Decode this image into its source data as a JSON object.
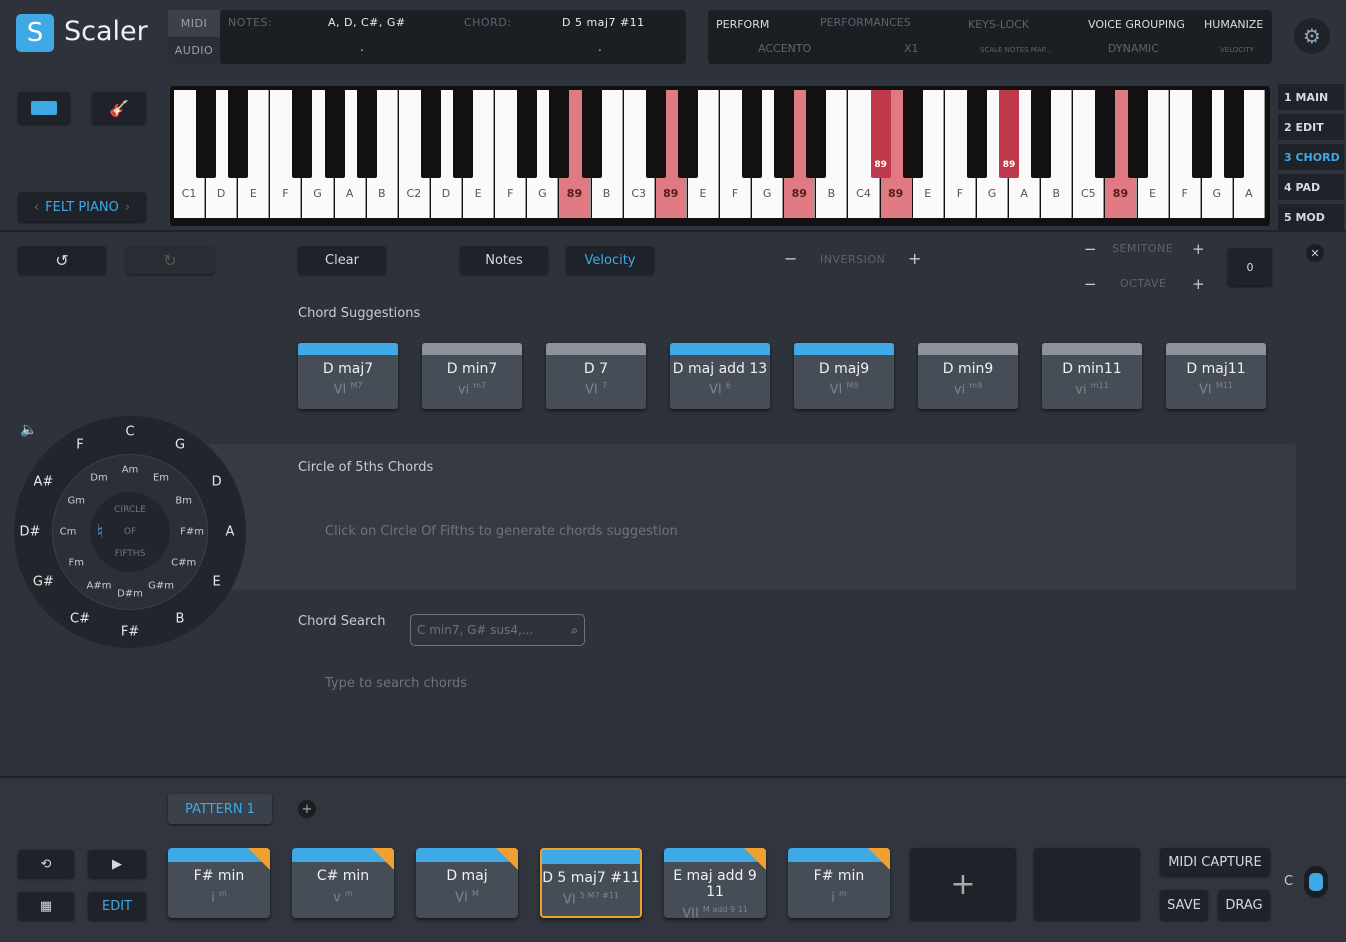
{
  "app": {
    "name": "Scaler",
    "logo_glyph": "S"
  },
  "header": {
    "midi": "MIDI",
    "audio": "AUDIO",
    "notes_label": "NOTES:",
    "notes_value": "A, D, C#, G#",
    "notes_audio": ".",
    "chord_label": "CHORD:",
    "chord_value": "D 5 maj7 #11",
    "chord_audio": ".",
    "perform": "PERFORM",
    "performances": "PERFORMANCES",
    "accento": "ACCENTO",
    "x1": "X1",
    "keys_lock": "KEYS-LOCK",
    "scale_notes_map": "SCALE NOTES MAP...",
    "voice_grouping": "VOICE GROUPING",
    "dynamic": "DYNAMIC",
    "humanize": "HUMANIZE",
    "velocity": "VELOCITY"
  },
  "instrument": {
    "name": "FELT PIANO"
  },
  "piano": {
    "white": [
      "C1",
      "D",
      "E",
      "F",
      "G",
      "A",
      "B",
      "C2",
      "D",
      "E",
      "F",
      "G",
      "89",
      "B",
      "C3",
      "89",
      "E",
      "F",
      "G",
      "89",
      "B",
      "C4",
      "89",
      "E",
      "F",
      "G",
      "A",
      "B",
      "C5",
      "89",
      "E",
      "F",
      "G",
      "A"
    ],
    "white_on": [
      12,
      15,
      19,
      22,
      29
    ],
    "black_on_label": "89",
    "black_on": [
      "C#4",
      "G#4"
    ]
  },
  "sidebar": [
    {
      "label": "1  MAIN"
    },
    {
      "label": "2  EDIT"
    },
    {
      "label": "3  CHORD",
      "active": true
    },
    {
      "label": "4  PAD"
    },
    {
      "label": "5  MOD"
    }
  ],
  "toolbar": {
    "clear": "Clear",
    "notes": "Notes",
    "velocity": "Velocity",
    "inversion": "INVERSION",
    "semitone": "SEMITONE",
    "octave": "OCTAVE",
    "transpose_value": "0",
    "minus": "−",
    "plus": "+"
  },
  "suggestions": {
    "title": "Chord Suggestions",
    "items": [
      {
        "name": "D maj7",
        "roman": "VI",
        "sup": "M7",
        "blue": true
      },
      {
        "name": "D min7",
        "roman": "vi",
        "sup": "m7",
        "blue": false
      },
      {
        "name": "D 7",
        "roman": "VI",
        "sup": "7",
        "blue": false
      },
      {
        "name": "D maj add 13",
        "roman": "VI",
        "sup": "6",
        "blue": true
      },
      {
        "name": "D maj9",
        "roman": "VI",
        "sup": "M9",
        "blue": true
      },
      {
        "name": "D min9",
        "roman": "vi",
        "sup": "m9",
        "blue": false
      },
      {
        "name": "D min11",
        "roman": "vi",
        "sup": "m11",
        "blue": false
      },
      {
        "name": "D maj11",
        "roman": "VI",
        "sup": "M11",
        "blue": false
      }
    ]
  },
  "circle": {
    "title": "Circle of 5ths Chords",
    "hint": "Click on Circle Of Fifths to generate chords suggestion",
    "center": [
      "CIRCLE",
      "OF",
      "FIFTHS"
    ],
    "major": [
      "C",
      "G",
      "D",
      "A",
      "E",
      "B",
      "F#",
      "C#",
      "G#",
      "D#",
      "A#",
      "F"
    ],
    "minor": [
      "Am",
      "Em",
      "Bm",
      "F#m",
      "C#m",
      "G#m",
      "D#m",
      "A#m",
      "Fm",
      "Cm",
      "Gm",
      "Dm"
    ]
  },
  "search": {
    "label": "Chord Search",
    "placeholder": "C min7, G# sus4,...",
    "hint": "Type to search chords"
  },
  "pattern": {
    "tab": "PATTERN 1",
    "edit": "EDIT",
    "midi_capture": "MIDI CAPTURE",
    "save": "SAVE",
    "drag": "DRAG",
    "key": "C",
    "add": "+",
    "chords": [
      {
        "name": "F# min",
        "roman": "i",
        "sup": "m",
        "tag": true
      },
      {
        "name": "C# min",
        "roman": "v",
        "sup": "m",
        "tag": true
      },
      {
        "name": "D maj",
        "roman": "VI",
        "sup": "M",
        "tag": true
      },
      {
        "name": "D 5 maj7 #11",
        "roman": "VI",
        "sup": "5 M7 #11",
        "tag": false,
        "selected": true
      },
      {
        "name": "E maj add 9 11",
        "roman": "VII",
        "sup": "M add 9 11",
        "tag": true
      },
      {
        "name": "F# min",
        "roman": "i",
        "sup": "m",
        "tag": true
      }
    ]
  },
  "colors": {
    "accent": "#3fa9e6",
    "active_key": "#e07a82",
    "selected": "#f0a030"
  }
}
